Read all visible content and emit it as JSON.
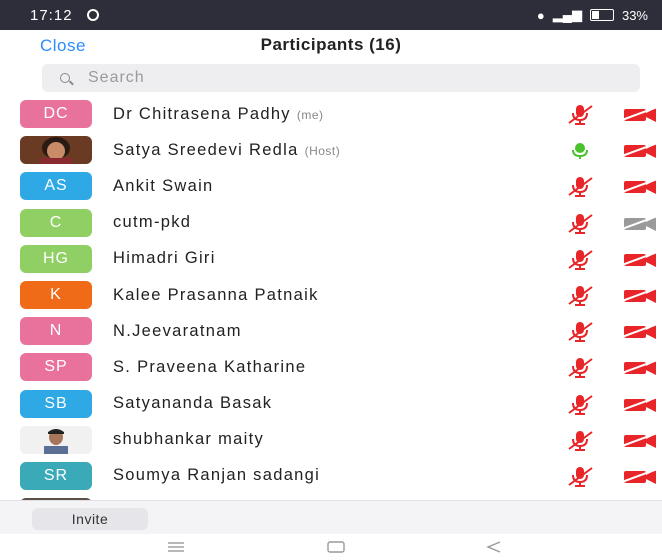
{
  "status": {
    "time": "17:12",
    "battery": "33%"
  },
  "header": {
    "close_label": "Close",
    "title": "Participants (16)"
  },
  "search": {
    "placeholder": "Search"
  },
  "participants": [
    {
      "initials": "DC",
      "color": "#e8729c",
      "name": "Dr Chitrasena Padhy",
      "tag": "(me)",
      "mic": "muted",
      "camera": "off"
    },
    {
      "initials": "",
      "photo": true,
      "name": "Satya Sreedevi Redla",
      "tag": "(Host)",
      "mic": "active",
      "camera": "off"
    },
    {
      "initials": "AS",
      "color": "#2fa8e6",
      "name": "Ankit Swain",
      "tag": "",
      "mic": "muted",
      "camera": "off"
    },
    {
      "initials": "C",
      "color": "#8fcf63",
      "name": "cutm-pkd",
      "tag": "",
      "mic": "muted",
      "camera": "unavailable"
    },
    {
      "initials": "HG",
      "color": "#8fcf63",
      "name": "Himadri Giri",
      "tag": "",
      "mic": "muted",
      "camera": "off"
    },
    {
      "initials": "K",
      "color": "#ef6b17",
      "name": "Kalee Prasanna Patnaik",
      "tag": "",
      "mic": "muted",
      "camera": "off"
    },
    {
      "initials": "N",
      "color": "#e8729c",
      "name": "N.Jeevaratnam",
      "tag": "",
      "mic": "muted",
      "camera": "off"
    },
    {
      "initials": "SP",
      "color": "#e8729c",
      "name": "S. Praveena Katharine",
      "tag": "",
      "mic": "muted",
      "camera": "off"
    },
    {
      "initials": "SB",
      "color": "#2fa8e6",
      "name": "Satyananda Basak",
      "tag": "",
      "mic": "muted",
      "camera": "off"
    },
    {
      "initials": "",
      "photo": true,
      "name": "shubhankar maity",
      "tag": "",
      "mic": "muted",
      "camera": "off"
    },
    {
      "initials": "SR",
      "color": "#3aa9b8",
      "name": "Soumya Ranjan sadangi",
      "tag": "",
      "mic": "muted",
      "camera": "off"
    }
  ],
  "footer": {
    "invite_label": "Invite"
  },
  "colors": {
    "accent": "#2d8cff",
    "muted_red": "#e8262a",
    "active_green": "#4cc12e",
    "statusbar": "#2e2e3a"
  },
  "icons": {
    "mic_muted": "mic-muted-icon",
    "mic_active": "mic-active-icon",
    "camera_off": "video-off-icon",
    "nav_menu": "menu-icon",
    "nav_home": "home-icon",
    "nav_back": "back-icon"
  }
}
